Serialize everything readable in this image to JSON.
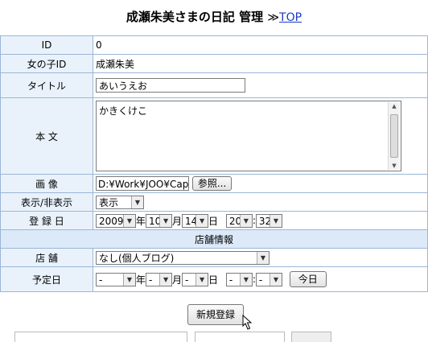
{
  "header": {
    "title": "成瀬朱美さまの日記 管理",
    "separator": "≫",
    "top_link": "TOP"
  },
  "fields": {
    "id": {
      "label": "ID",
      "value": "0"
    },
    "girl_id": {
      "label": "女の子ID",
      "value": "成瀬朱美"
    },
    "title": {
      "label": "タイトル",
      "value": "あいうえお"
    },
    "body": {
      "label": "本 文",
      "value": "かきくけこ"
    },
    "image": {
      "label": "画 像",
      "value": "D:¥Work¥JOO¥Capt",
      "browse_button": "参照..."
    },
    "visibility": {
      "label": "表示/非表示",
      "value": "表示"
    },
    "reg_date": {
      "label": "登 録 日",
      "year": "2009",
      "year_unit": "年",
      "month": "10",
      "month_unit": "月",
      "day": "14",
      "day_unit": "日",
      "hour": "20",
      "colon": ":",
      "minute": "32"
    }
  },
  "section_header": "店舗情報",
  "store": {
    "label": "店 舗",
    "value": "なし(個人ブログ)"
  },
  "schedule": {
    "label": "予定日",
    "year": "-",
    "year_unit": "年",
    "month": "-",
    "month_unit": "月",
    "day": "-",
    "day_unit": "日",
    "hour": "-",
    "colon": ":",
    "minute": "-",
    "today_button": "今日"
  },
  "submit_button": "新規登録"
}
